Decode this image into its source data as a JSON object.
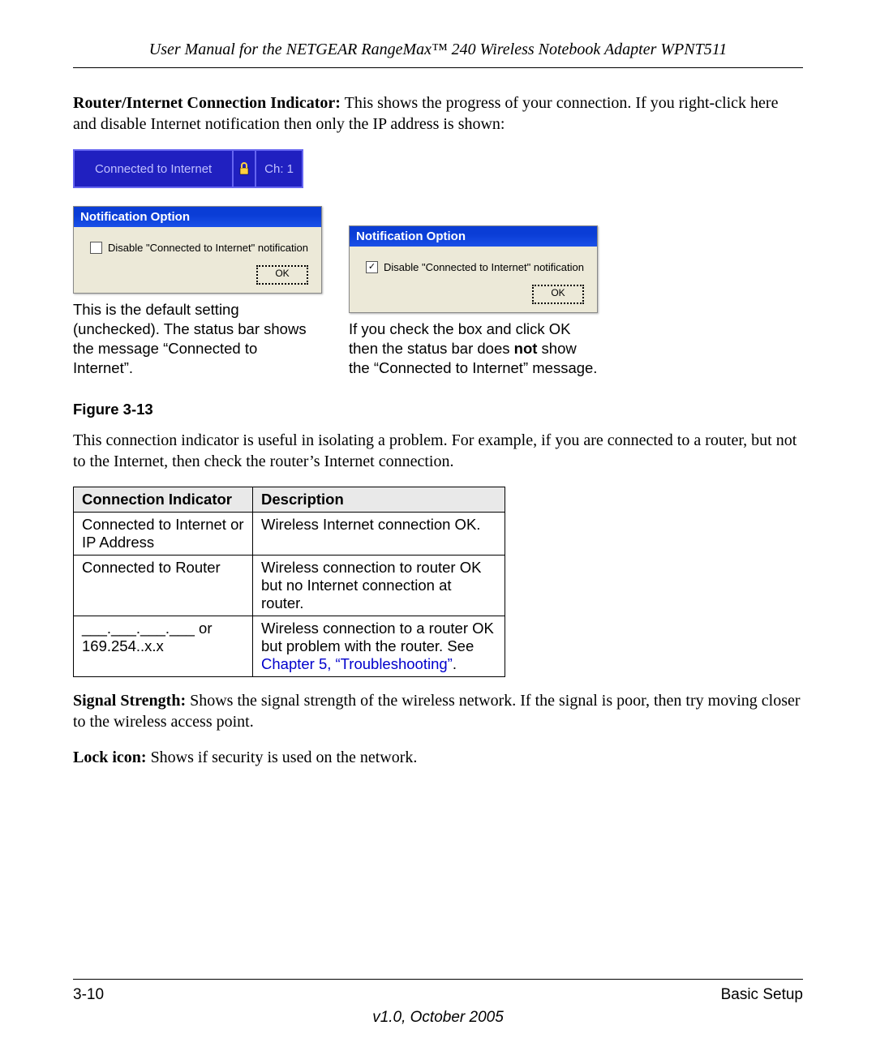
{
  "header": {
    "title": "User Manual for the NETGEAR RangeMax™ 240 Wireless Notebook Adapter WPNT511"
  },
  "para1": {
    "lead": "Router/Internet Connection Indicator:",
    "rest": " This shows the progress of your connection. If you right-click here and disable Internet notification then only the IP address is shown:"
  },
  "status_bar": {
    "connected": "Connected to Internet",
    "channel": "Ch: 1"
  },
  "dialog": {
    "title": "Notification Option",
    "checkbox_label": "Disable \"Connected to Internet\" notification",
    "ok": "OK"
  },
  "captions": {
    "left": "This is the default setting (unchecked). The status bar shows the message “Connected to Internet”.",
    "right_a": "If you check the box and click OK then the status bar does ",
    "right_b": "not",
    "right_c": " show the “Connected to Internet” message."
  },
  "figure_label": "Figure 3-13",
  "para2": "This connection indicator is useful in isolating a problem. For example, if you are connected to a router, but not to the Internet, then check the router’s Internet connection.",
  "table": {
    "headers": {
      "a": "Connection Indicator",
      "b": "Description"
    },
    "rows": [
      {
        "a": "Connected to Internet or IP Address",
        "b": "Wireless Internet connection OK."
      },
      {
        "a": "Connected to Router",
        "b": "Wireless connection to router OK but no Internet connection at router."
      },
      {
        "a": "___.___.___.___ or 169.254..x.x",
        "b_pre": "Wireless connection to a router OK but problem with the router. See ",
        "b_link": "Chapter 5, “Troubleshooting”",
        "b_post": "."
      }
    ]
  },
  "para3": {
    "lead": "Signal Strength:",
    "rest": " Shows the signal strength of the wireless network. If the signal is poor, then try moving closer to the wireless access point."
  },
  "para4": {
    "lead": "Lock icon:",
    "rest": " Shows if security is used on the network."
  },
  "footer": {
    "left": "3-10",
    "right": "Basic Setup",
    "version": "v1.0, October 2005"
  }
}
